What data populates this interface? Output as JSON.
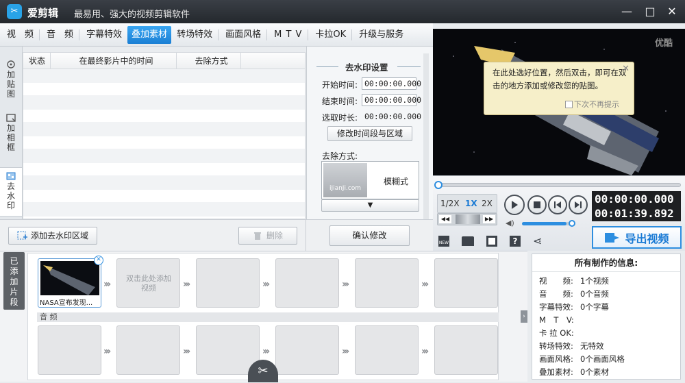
{
  "app": {
    "name": "爱剪辑",
    "slogan": "最易用、强大的视频剪辑软件"
  },
  "tabs": [
    {
      "label": "视　频"
    },
    {
      "label": "音　频"
    },
    {
      "label": "字幕特效"
    },
    {
      "label": "叠加素材",
      "active": true
    },
    {
      "label": "转场特效"
    },
    {
      "label": "画面风格"
    },
    {
      "label": "M T V"
    },
    {
      "label": "卡拉OK"
    },
    {
      "label": "升级与服务"
    }
  ],
  "side_tabs": {
    "add_sticker": "加贴图",
    "add_frame": "加相框",
    "remove_watermark": "去水印"
  },
  "list": {
    "headers": [
      "状态",
      "在最终影片中的时间",
      "去除方式"
    ]
  },
  "watermark": {
    "title": "去水印设置",
    "start_label": "开始时间:",
    "start_value": "00:00:00.000",
    "end_label": "结束时间:",
    "end_value": "00:00:00.000",
    "duration_label": "选取时长:",
    "duration_value": "00:00:00.000",
    "modify_button": "修改时间段与区域",
    "method_label": "去除方式:",
    "method_thumb_text": "iJianJi.com",
    "method_value": "模糊式",
    "confirm_button": "确认修改"
  },
  "bottom": {
    "add_region": "添加去水印区域",
    "delete": "删除"
  },
  "preview": {
    "watermark": "优酷",
    "tooltip_text": "在此处选好位置，然后双击，即可在双击的地方添加或修改您的贴图。",
    "tooltip_checkbox": "下次不再提示"
  },
  "player": {
    "speeds": [
      "1/2X",
      "1X",
      "2X"
    ],
    "active_speed": "1X",
    "current_time": "00:00:00.000",
    "total_time": "00:01:39.892",
    "progress": 0,
    "volume": 0.88,
    "export_label": "导出视频"
  },
  "timeline": {
    "added_tab": "已添加片段",
    "clip1_label": "NASA宣布发现...",
    "empty_hint": "双击此处添加视频",
    "audio_label": "音 频"
  },
  "info": {
    "title": "所有制作的信息:",
    "rows": [
      {
        "key": "视　　频:",
        "val": "1个视频"
      },
      {
        "key": "音　　频:",
        "val": "0个音频"
      },
      {
        "key": "字幕特效:",
        "val": "0个字幕"
      },
      {
        "key": "M　T　V:",
        "val": ""
      },
      {
        "key": "卡 拉 OK:",
        "val": ""
      },
      {
        "key": "转场特效:",
        "val": "无特效"
      },
      {
        "key": "画面风格:",
        "val": "0个画面风格"
      },
      {
        "key": "叠加素材:",
        "val": "0个素材"
      }
    ]
  },
  "colors": {
    "accent": "#1b7fd4",
    "titlebar": "#2b2f34",
    "tooltip_bg": "#f6efc9"
  }
}
